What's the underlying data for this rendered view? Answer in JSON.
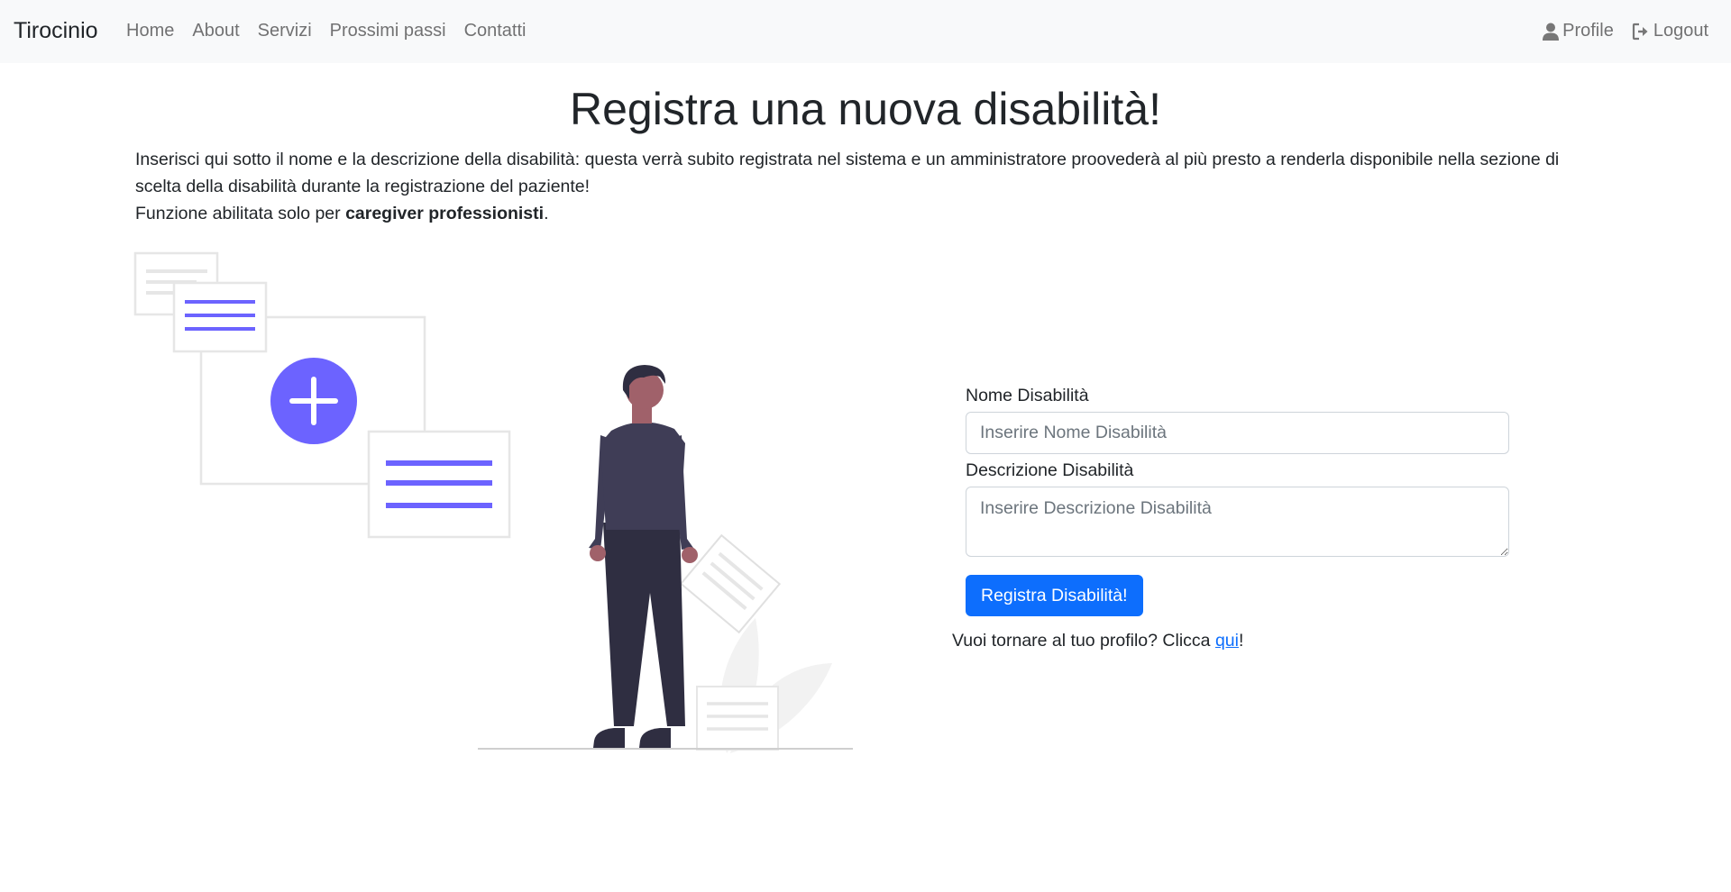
{
  "navbar": {
    "brand": "Tirocinio",
    "links": [
      "Home",
      "About",
      "Servizi",
      "Prossimi passi",
      "Contatti"
    ],
    "profile_label": "Profile",
    "logout_label": "Logout"
  },
  "page": {
    "title": "Registra una nuova disabilità!",
    "intro_text": "Inserisci qui sotto il nome e la descrizione della disabilità: questa verrà subito registrata nel sistema e un amministratore proovederà al più presto a renderla disponibile nella sezione di scelta della disabilità durante la registrazione del paziente!",
    "intro_line2_prefix": "Funzione abilitata solo per ",
    "intro_line2_bold": "caregiver professionisti",
    "intro_line2_suffix": "."
  },
  "form": {
    "name_label": "Nome Disabilità",
    "name_placeholder": "Inserire Nome Disabilità",
    "name_value": "",
    "description_label": "Descrizione Disabilità",
    "description_placeholder": "Inserire Descrizione Disabilità",
    "description_value": "",
    "submit_label": "Registra Disabilità!"
  },
  "back": {
    "prefix": "Vuoi tornare al tuo profilo? Clicca ",
    "link": "qui",
    "suffix": "!"
  },
  "colors": {
    "accent": "#6c63ff",
    "primary": "#0d6efd",
    "navbar_bg": "#f8f9fa"
  }
}
